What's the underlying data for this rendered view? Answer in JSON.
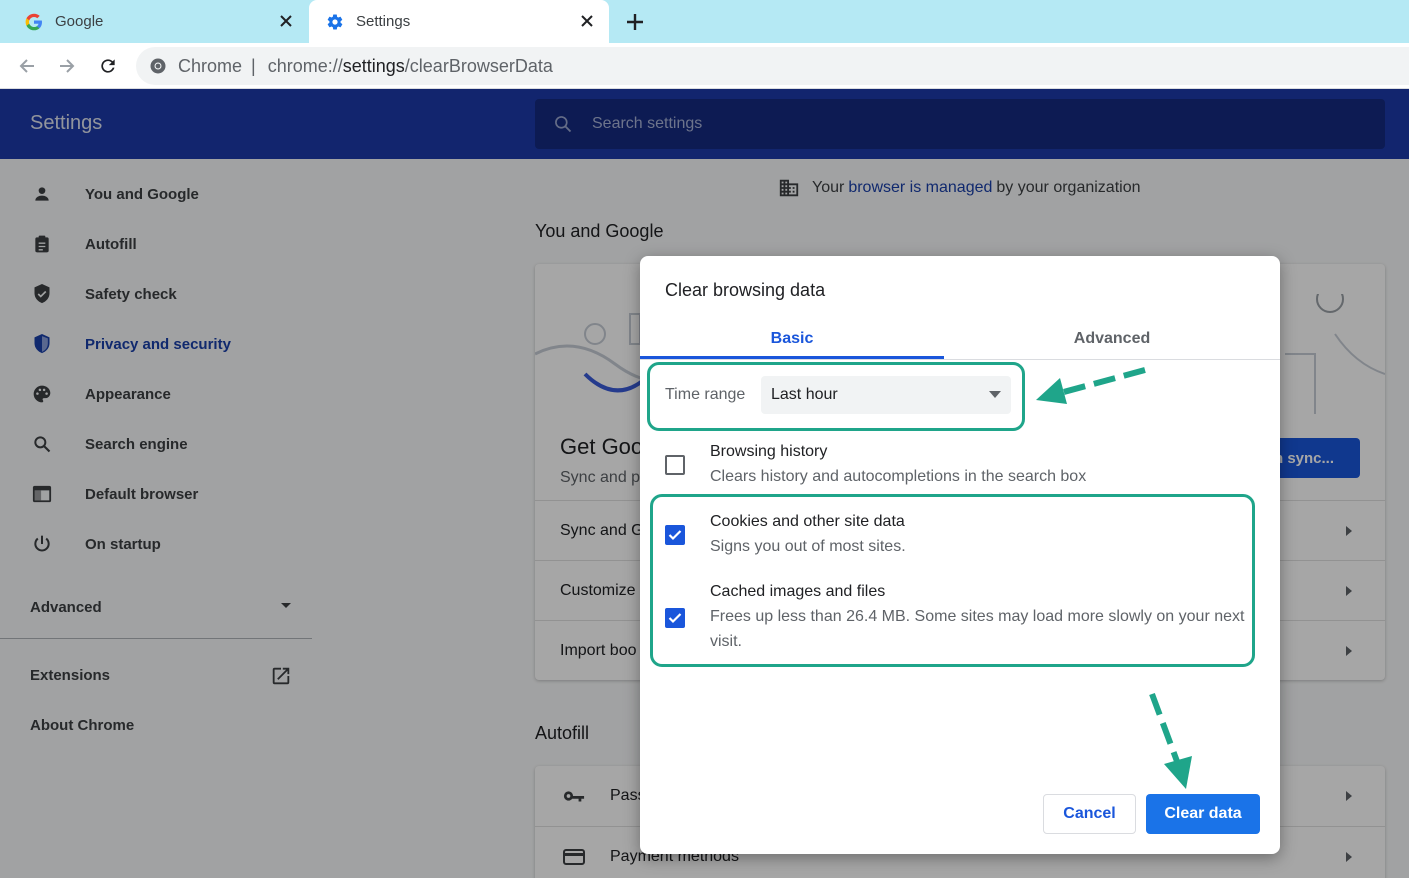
{
  "browser": {
    "tabs": [
      {
        "title": "Google",
        "icon": "google-g-icon"
      },
      {
        "title": "Settings",
        "icon": "gear-icon"
      }
    ],
    "address": {
      "origin": "Chrome",
      "separator": "|",
      "url_prefix": "chrome://",
      "url_strong": "settings",
      "url_suffix": "/clearBrowserData"
    }
  },
  "settings": {
    "title": "Settings",
    "search_placeholder": "Search settings",
    "sidebar": {
      "items": [
        {
          "label": "You and Google",
          "icon": "person-icon"
        },
        {
          "label": "Autofill",
          "icon": "clipboard-icon"
        },
        {
          "label": "Safety check",
          "icon": "shield-check-icon"
        },
        {
          "label": "Privacy and security",
          "icon": "shield-icon"
        },
        {
          "label": "Appearance",
          "icon": "palette-icon"
        },
        {
          "label": "Search engine",
          "icon": "search-icon"
        },
        {
          "label": "Default browser",
          "icon": "browser-window-icon"
        },
        {
          "label": "On startup",
          "icon": "power-icon"
        }
      ],
      "advanced": "Advanced",
      "extensions": "Extensions",
      "about": "About Chrome"
    },
    "managed": {
      "prefix": "Your",
      "link": "browser is managed",
      "suffix": "by your organization"
    },
    "you_and_google": {
      "heading": "You and Google",
      "card_title": "Get Goo",
      "card_sub": "Sync and p",
      "sync_button": "n sync...",
      "rows": [
        "Sync and G",
        "Customize",
        "Import boo"
      ]
    },
    "autofill": {
      "heading": "Autofill",
      "rows": [
        "Pass",
        "Payment methods"
      ]
    }
  },
  "dialog": {
    "title": "Clear browsing data",
    "tabs": {
      "basic": "Basic",
      "advanced": "Advanced"
    },
    "time_range": {
      "label": "Time range",
      "value": "Last hour"
    },
    "options": [
      {
        "title": "Browsing history",
        "desc": "Clears history and autocompletions in the search box",
        "checked": false
      },
      {
        "title": "Cookies and other site data",
        "desc": "Signs you out of most sites.",
        "checked": true
      },
      {
        "title": "Cached images and files",
        "desc": "Frees up less than 26.4 MB. Some sites may load more slowly on your next visit.",
        "checked": true
      }
    ],
    "cancel": "Cancel",
    "clear": "Clear data"
  },
  "colors": {
    "accent": "#1a73e8",
    "header": "#1c3aa9",
    "annotation": "#1fa58a"
  }
}
